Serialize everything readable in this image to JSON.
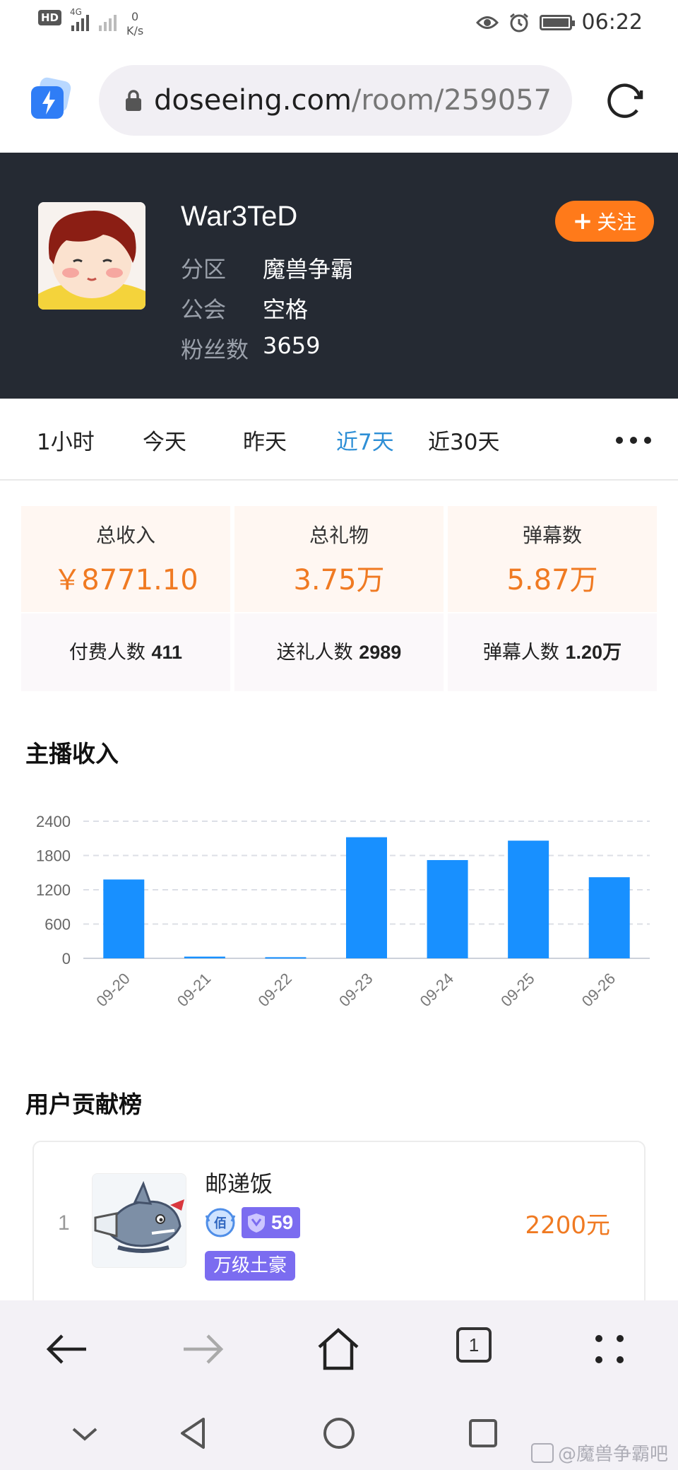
{
  "status_bar": {
    "hd_label": "HD",
    "network_label": "4G",
    "speed_value": "0",
    "speed_unit": "K/s",
    "time": "06:22"
  },
  "browser": {
    "url_domain": "doseeing.com",
    "url_path": "/room/259057",
    "tab_count": "1"
  },
  "header": {
    "streamer_name": "War3TeD",
    "follow_label": "关注",
    "info": [
      {
        "key": "分区",
        "value": "魔兽争霸"
      },
      {
        "key": "公会",
        "value": "空格"
      },
      {
        "key": "粉丝数",
        "value": "3659"
      }
    ]
  },
  "tabs": [
    "1小时",
    "今天",
    "昨天",
    "近7天",
    "近30天"
  ],
  "active_tab": "近7天",
  "stats": {
    "top": [
      {
        "label": "总收入",
        "value": "￥8771.10"
      },
      {
        "label": "总礼物",
        "value": "3.75万"
      },
      {
        "label": "弹幕数",
        "value": "5.87万"
      }
    ],
    "bottom": [
      {
        "label": "付费人数",
        "value": "411"
      },
      {
        "label": "送礼人数",
        "value": "2989"
      },
      {
        "label": "弹幕人数",
        "value": "1.20万"
      }
    ]
  },
  "income_section_title": "主播收入",
  "chart_data": {
    "type": "bar",
    "categories": [
      "09-20",
      "09-21",
      "09-22",
      "09-23",
      "09-24",
      "09-25",
      "09-26"
    ],
    "values": [
      1380,
      30,
      20,
      2120,
      1720,
      2060,
      1420
    ],
    "yticks": [
      0,
      600,
      1200,
      1800,
      2400
    ],
    "ylim": [
      0,
      2400
    ],
    "bar_color": "#1890ff",
    "grid": true
  },
  "contrib_section_title": "用户贡献榜",
  "contributors": [
    {
      "rank": "1",
      "name": "邮递饭",
      "badge_level": "59",
      "tag": "万级土豪",
      "amount": "2200元"
    }
  ],
  "watermark": "@魔兽争霸吧",
  "colors": {
    "accent_orange": "#f07a22",
    "follow_button": "#ff7a1a",
    "active_tab": "#2e8fd6",
    "header_bg": "#252a33",
    "badge_purple": "#7b6cf0"
  }
}
